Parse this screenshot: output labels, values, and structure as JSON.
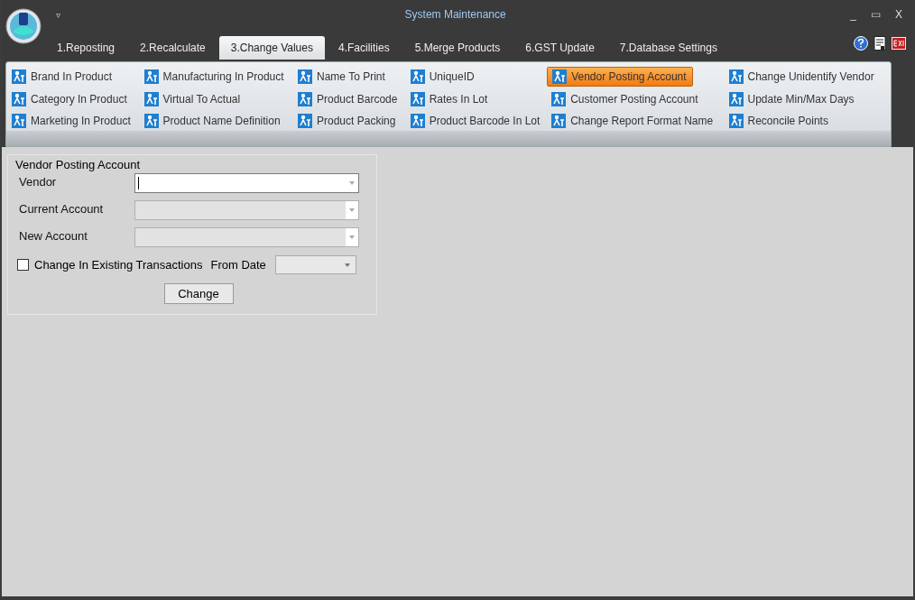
{
  "window": {
    "title": "System Maintenance",
    "menu_glyph": "▿",
    "controls": [
      "_",
      "▭",
      "X"
    ]
  },
  "tabs": [
    {
      "label": "1.Reposting",
      "selected": false
    },
    {
      "label": "2.Recalculate",
      "selected": false
    },
    {
      "label": "3.Change Values",
      "selected": true
    },
    {
      "label": "4.Facilities",
      "selected": false
    },
    {
      "label": "5.Merge Products",
      "selected": false
    },
    {
      "label": "6.GST Update",
      "selected": false
    },
    {
      "label": "7.Database Settings",
      "selected": false
    }
  ],
  "ribbon_columns": [
    {
      "items": [
        {
          "label": "Brand In Product",
          "selected": false
        },
        {
          "label": "Category In Product",
          "selected": false
        },
        {
          "label": "Marketing In Product",
          "selected": false
        }
      ]
    },
    {
      "items": [
        {
          "label": "Manufacturing In Product",
          "selected": false
        },
        {
          "label": "Virtual To Actual",
          "selected": false
        },
        {
          "label": "Product Name Definition",
          "selected": false
        }
      ]
    },
    {
      "items": [
        {
          "label": "Name To Print",
          "selected": false
        },
        {
          "label": "Product Barcode",
          "selected": false
        },
        {
          "label": "Product Packing",
          "selected": false
        }
      ]
    },
    {
      "items": [
        {
          "label": "UniqueID",
          "selected": false
        },
        {
          "label": "Rates In Lot",
          "selected": false
        },
        {
          "label": "Product Barcode In Lot",
          "selected": false
        }
      ]
    },
    {
      "items": [
        {
          "label": "Vendor Posting Account",
          "selected": true
        },
        {
          "label": "Customer Posting Account",
          "selected": false
        },
        {
          "label": "Change Report Format Name",
          "selected": false
        }
      ]
    },
    {
      "items": [
        {
          "label": "Change Unidentify Vendor",
          "selected": false
        },
        {
          "label": "Update Min/Max Days",
          "selected": false
        },
        {
          "label": "Reconcile Points",
          "selected": false
        }
      ]
    }
  ],
  "form": {
    "title": "Vendor Posting Account",
    "fields": [
      {
        "label": "Vendor",
        "disabled": false
      },
      {
        "label": "Current Account",
        "disabled": true
      },
      {
        "label": "New Account",
        "disabled": true
      }
    ],
    "checkbox": {
      "label": "Change In Existing Transactions",
      "checked": false
    },
    "from_date": {
      "label": "From Date",
      "disabled": true
    },
    "button": "Change"
  }
}
